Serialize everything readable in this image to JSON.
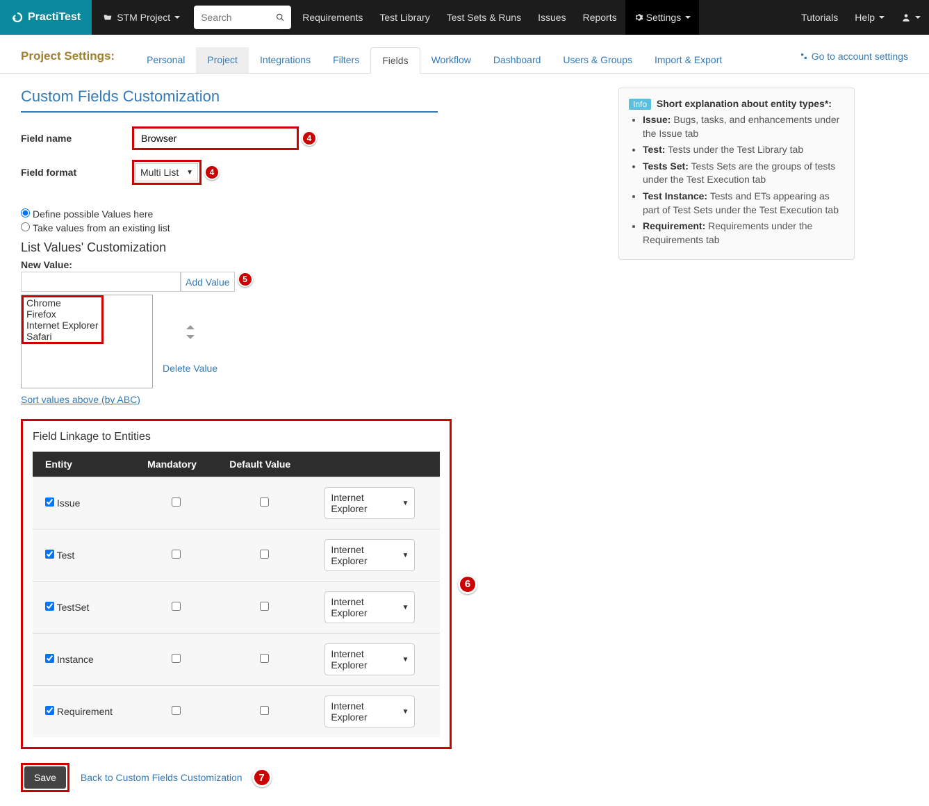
{
  "topnav": {
    "logo": "PractiTest",
    "project": "STM Project",
    "search_placeholder": "Search",
    "links": [
      "Requirements",
      "Test Library",
      "Test Sets & Runs",
      "Issues",
      "Reports"
    ],
    "settings": "Settings",
    "tutorials": "Tutorials",
    "help": "Help"
  },
  "subnav": {
    "title": "Project Settings:",
    "tabs": [
      "Personal",
      "Project",
      "Integrations",
      "Filters",
      "Fields",
      "Workflow",
      "Dashboard",
      "Users & Groups",
      "Import & Export"
    ],
    "right": "Go to account settings"
  },
  "page_title": "Custom Fields Customization",
  "form": {
    "name_label": "Field name",
    "name_value": "Browser",
    "format_label": "Field format",
    "format_value": "Multi List",
    "radio1": "Define possible Values here",
    "radio2": "Take values from an existing list"
  },
  "listvals": {
    "section": "List Values' Customization",
    "newval_label": "New Value:",
    "add_btn": "Add Value",
    "items": [
      "Chrome",
      "Firefox",
      "Internet Explorer",
      "Safari"
    ],
    "delete": "Delete Value",
    "sort": "Sort values above (by ABC)"
  },
  "linkage": {
    "title": "Field Linkage to Entities",
    "headers": [
      "Entity",
      "Mandatory",
      "Default Value"
    ],
    "rows": [
      {
        "entity": "Issue",
        "default": "Internet Explorer"
      },
      {
        "entity": "Test",
        "default": "Internet Explorer"
      },
      {
        "entity": "TestSet",
        "default": "Internet Explorer"
      },
      {
        "entity": "Instance",
        "default": "Internet Explorer"
      },
      {
        "entity": "Requirement",
        "default": "Internet Explorer"
      }
    ]
  },
  "save_btn": "Save",
  "back_link": "Back to Custom Fields Customization",
  "info": {
    "badge": "Info",
    "title": "Short explanation about entity types*:",
    "items": [
      {
        "b": "Issue:",
        "t": "Bugs, tasks, and enhancements under the Issue tab"
      },
      {
        "b": "Test:",
        "t": "Tests under the Test Library tab"
      },
      {
        "b": "Tests Set:",
        "t": "Tests Sets are the groups of tests under the Test Execution tab"
      },
      {
        "b": "Test Instance:",
        "t": "Tests and ETs appearing as part of Test Sets under the Test Execution tab"
      },
      {
        "b": "Requirement:",
        "t": "Requirements under the Requirements tab"
      }
    ]
  },
  "badges": {
    "b4": "4",
    "b5": "5",
    "b6": "6",
    "b7": "7"
  }
}
